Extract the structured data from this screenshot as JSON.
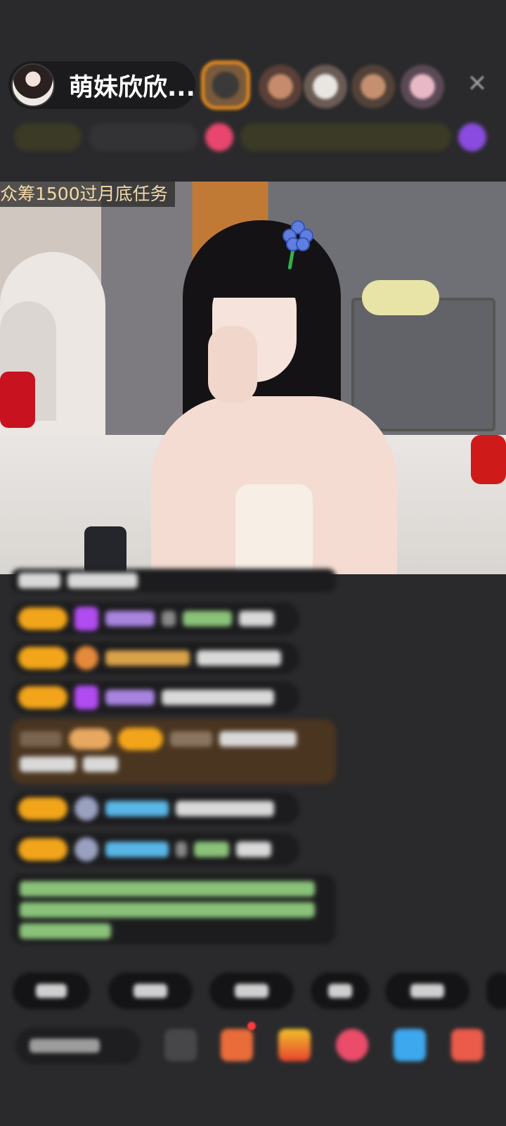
{
  "header": {
    "host_name": "萌妹欣欣...",
    "task_label": "众筹1500过月底任务"
  },
  "colors": {
    "background": "#2a2a2c",
    "level_badge": "#f2a51a",
    "highlight_message": "#4a3520",
    "top_viewer_ring": "#e58b1e"
  },
  "icons": {
    "close": "close-icon",
    "flower_clip": "flower-sticker",
    "gift_box": "gift-box-icon",
    "red_dot": "notification-dot"
  }
}
